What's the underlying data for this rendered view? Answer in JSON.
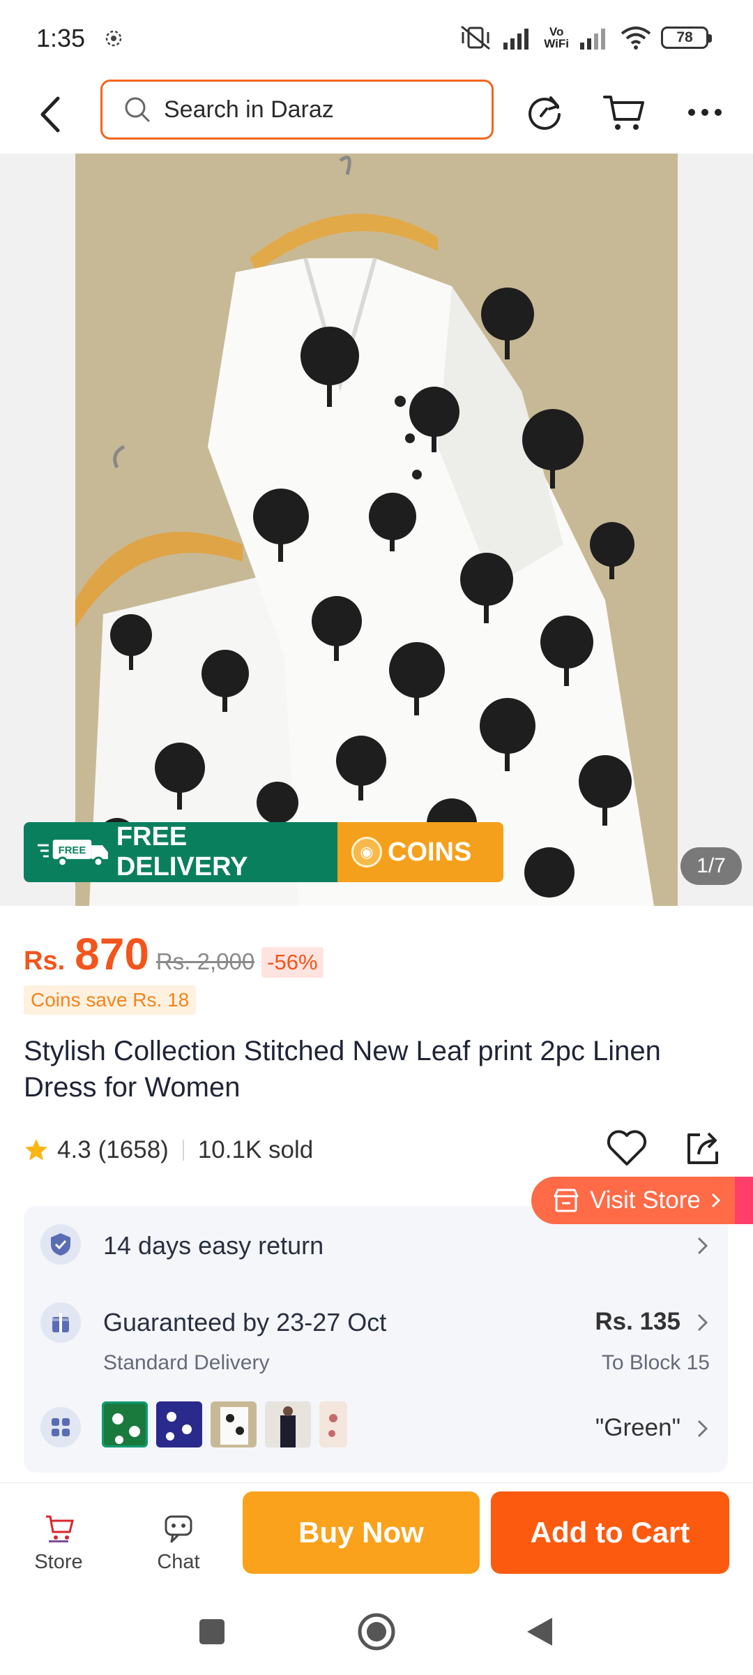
{
  "status_bar": {
    "time": "1:35",
    "battery": "78",
    "vowifi_top": "Vo",
    "vowifi_bottom": "WiFi"
  },
  "header": {
    "search_placeholder": "Search in Daraz"
  },
  "gallery": {
    "page_indicator": "1/7",
    "promo_free_badge": "FREE",
    "promo_delivery": "FREE DELIVERY",
    "promo_coins": "COINS"
  },
  "product": {
    "currency": "Rs.",
    "price": "870",
    "original_price": "Rs. 2,000",
    "discount": "-56%",
    "coins_save": "Coins save Rs. 18",
    "title": "Stylish Collection Stitched New Leaf print 2pc Linen Dress for Women",
    "rating": "4.3",
    "reviews": "(1658)",
    "sold": "10.1K sold",
    "visit_store": "Visit Store"
  },
  "info": {
    "returns": "14 days easy return",
    "delivery_title": "Guaranteed by 23-27 Oct",
    "delivery_type": "Standard Delivery",
    "delivery_fee": "Rs. 135",
    "delivery_to": "To Block 15",
    "variant_selected": "\"Green\""
  },
  "bottom_bar": {
    "store_label": "Store",
    "chat_label": "Chat",
    "buy_now": "Buy Now",
    "add_to_cart": "Add to Cart"
  },
  "colors": {
    "accent": "#f2551c",
    "buy_now": "#faa21b",
    "add_to_cart": "#fc5a0f",
    "free_delivery": "#0a7f5e"
  }
}
